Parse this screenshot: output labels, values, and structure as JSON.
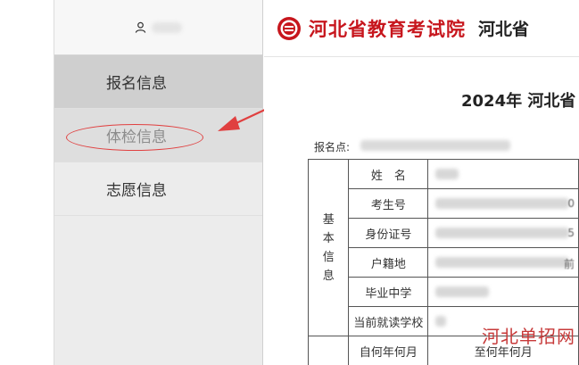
{
  "user": {
    "icon": "user-icon"
  },
  "sidebar": {
    "items": [
      {
        "label": "报名信息",
        "state": "active"
      },
      {
        "label": "体检信息",
        "state": "annotated"
      },
      {
        "label": "志愿信息",
        "state": "normal"
      }
    ]
  },
  "header": {
    "logo": "exam-authority-logo",
    "org_name": "河北省教育考试院",
    "org_name_2": "河北省"
  },
  "document": {
    "title": "2024年 河北省",
    "registration_label": "报名点:",
    "basic_info_group": "基本信息",
    "rows": [
      {
        "label": "姓　名",
        "tail": ""
      },
      {
        "label": "考生号",
        "tail": "0"
      },
      {
        "label": "身份证号",
        "tail": "5"
      },
      {
        "label": "户籍地",
        "tail": "前"
      },
      {
        "label": "毕业中学",
        "tail": ""
      },
      {
        "label": "当前就读学校",
        "tail": ""
      }
    ],
    "history_from": "自何年何月",
    "history_to": "至何年何月"
  },
  "watermark": "河北单招网",
  "colors": {
    "brand_red": "#c7161d",
    "annotation_red": "#e04040"
  }
}
